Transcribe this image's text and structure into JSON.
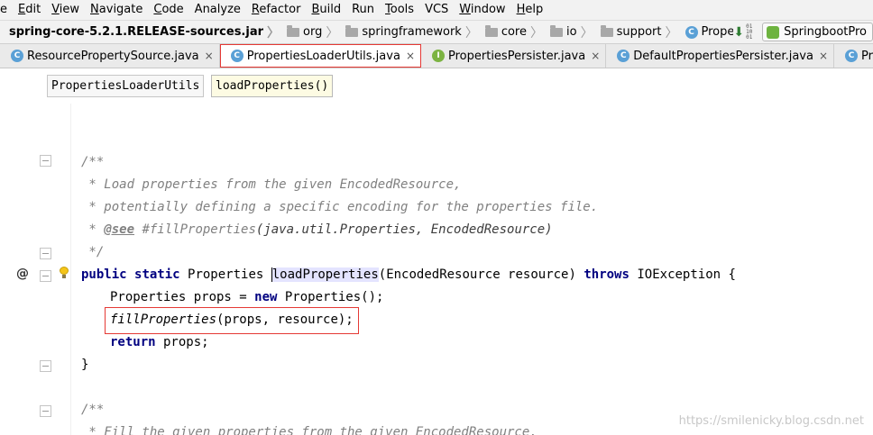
{
  "menubar": {
    "items": [
      {
        "first": "",
        "rest": "e"
      },
      {
        "first": "E",
        "rest": "dit"
      },
      {
        "first": "V",
        "rest": "iew"
      },
      {
        "first": "N",
        "rest": "avigate"
      },
      {
        "first": "C",
        "rest": "ode"
      },
      {
        "first": "",
        "rest": "Analyze"
      },
      {
        "first": "R",
        "rest": "efactor"
      },
      {
        "first": "B",
        "rest": "uild"
      },
      {
        "first": "",
        "rest": "Run"
      },
      {
        "first": "T",
        "rest": "ools"
      },
      {
        "first": "",
        "rest": "VCS"
      },
      {
        "first": "W",
        "rest": "indow"
      },
      {
        "first": "H",
        "rest": "elp"
      }
    ]
  },
  "navbar": {
    "jar": "spring-core-5.2.1.RELEASE-sources.jar",
    "crumbs": [
      "org",
      "springframework",
      "core",
      "io",
      "support"
    ],
    "current_class": "PropertiesLoaderUtils",
    "class_icon_letter": "C",
    "run_config": "SpringbootPro"
  },
  "tabs": [
    {
      "label": "ResourcePropertySource.java",
      "icon": "C",
      "kind": "class"
    },
    {
      "label": "PropertiesLoaderUtils.java",
      "icon": "C",
      "kind": "class"
    },
    {
      "label": "PropertiesPersister.java",
      "icon": "I",
      "kind": "interface"
    },
    {
      "label": "DefaultPropertiesPersister.java",
      "icon": "C",
      "kind": "class"
    },
    {
      "label": "Properties.java",
      "icon": "C",
      "kind": "class"
    }
  ],
  "tab_close_glyph": "×",
  "editor_crumbs": {
    "class_name": "PropertiesLoaderUtils",
    "method_name": "loadProperties()"
  },
  "code": {
    "clipped_top": "} ",
    "doc_open": "/**",
    "doc_line1": " * Load properties from the given EncodedResource,",
    "doc_line2": " * potentially defining a specific encoding for the properties file.",
    "doc_see_prefix": " * ",
    "doc_see_tag": "@see",
    "doc_see_ref": " #fillProperties",
    "doc_see_args": "(java.util.Properties, EncodedResource)",
    "doc_close": " */",
    "sig_public": "public",
    "sig_static": "static",
    "sig_type": " Properties ",
    "sig_method": "loadProperties",
    "sig_params": "(EncodedResource resource) ",
    "sig_throws": "throws",
    "sig_exception": " IOException {",
    "body1_type": "Properties props = ",
    "body1_new": "new",
    "body1_rest": " Properties();",
    "body2_call": "fillProperties",
    "body2_args": "(props, resource);",
    "body3_return": "return",
    "body3_rest": " props;",
    "close_brace": "}",
    "doc2_open": "/**",
    "doc2_line1": " * Fill the given properties from the given EncodedResource,"
  },
  "gutter": {
    "override_marker": "@"
  },
  "watermark": "https://smilenicky.blog.csdn.net"
}
